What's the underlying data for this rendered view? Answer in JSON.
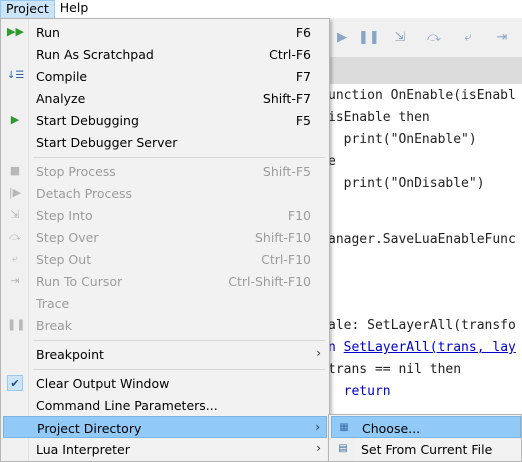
{
  "menubar": {
    "items": [
      "Project",
      "Help"
    ]
  },
  "editor": {
    "lines": [
      "unction OnEnable(isEnabl",
      "isEnable then",
      "  print(\"OnEnable\")",
      "e",
      "  print(\"OnDisable\")",
      "anager.SaveLuaEnableFunc",
      "ale: SetLayerAll(transfo",
      "SetLayerAll(trans, lay",
      "trans == nil then",
      "  return"
    ],
    "line7_prefix": "n ",
    "line8_kw": "then",
    "line9_kw": "return"
  },
  "menu": {
    "run": {
      "label": "Run",
      "shortcut": "F6",
      "icon": "play-double-icon"
    },
    "run_scratchpad": {
      "label": "Run As Scratchpad",
      "shortcut": "Ctrl-F6"
    },
    "compile": {
      "label": "Compile",
      "shortcut": "F7",
      "icon": "compile-icon"
    },
    "analyze": {
      "label": "Analyze",
      "shortcut": "Shift-F7"
    },
    "start_debugging": {
      "label": "Start Debugging",
      "shortcut": "F5",
      "icon": "play-icon"
    },
    "start_debugger_server": {
      "label": "Start Debugger Server"
    },
    "stop_process": {
      "label": "Stop Process",
      "shortcut": "Shift-F5"
    },
    "detach_process": {
      "label": "Detach Process"
    },
    "step_into": {
      "label": "Step Into",
      "shortcut": "F10"
    },
    "step_over": {
      "label": "Step Over",
      "shortcut": "Shift-F10"
    },
    "step_out": {
      "label": "Step Out",
      "shortcut": "Ctrl-F10"
    },
    "run_to_cursor": {
      "label": "Run To Cursor",
      "shortcut": "Ctrl-Shift-F10"
    },
    "trace": {
      "label": "Trace"
    },
    "break": {
      "label": "Break"
    },
    "breakpoint": {
      "label": "Breakpoint"
    },
    "clear_output": {
      "label": "Clear Output Window"
    },
    "cmdline": {
      "label": "Command Line Parameters..."
    },
    "project_directory": {
      "label": "Project Directory"
    },
    "lua_interpreter": {
      "label": "Lua Interpreter"
    }
  },
  "submenu": {
    "choose": {
      "label": "Choose..."
    },
    "set_from_current": {
      "label": "Set From Current File"
    }
  },
  "colors": {
    "highlight": "#91c9f7",
    "disabled_text": "#9c9c9c",
    "run_icon": "#2e9a2e"
  }
}
